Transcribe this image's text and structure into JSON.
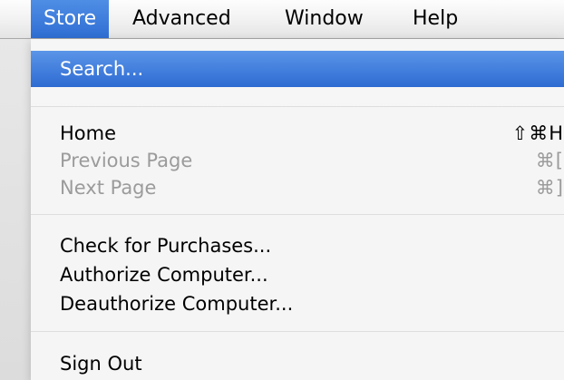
{
  "menubar": {
    "items": [
      {
        "label": "Store",
        "active": true
      },
      {
        "label": "Advanced"
      },
      {
        "label": "Window"
      },
      {
        "label": "Help"
      }
    ]
  },
  "store_menu": {
    "search": {
      "label": "Search..."
    },
    "home": {
      "label": "Home",
      "shortcut": "⇧⌘H"
    },
    "previous_page": {
      "label": "Previous Page",
      "shortcut": "⌘[",
      "enabled": false
    },
    "next_page": {
      "label": "Next Page",
      "shortcut": "⌘]",
      "enabled": false
    },
    "check_purchases": {
      "label": "Check for Purchases..."
    },
    "authorize": {
      "label": "Authorize Computer..."
    },
    "deauthorize": {
      "label": "Deauthorize Computer..."
    },
    "sign_out": {
      "label": "Sign Out"
    }
  },
  "colors": {
    "highlight": "#3478dc",
    "disabled_text": "#9b9b9b"
  }
}
